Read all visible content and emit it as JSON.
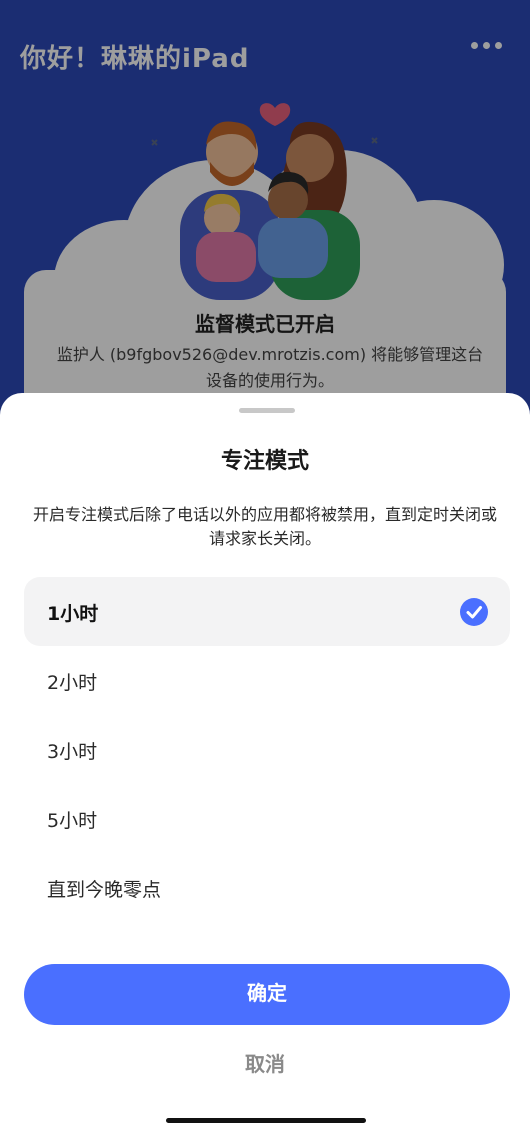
{
  "background": {
    "title": "你好！琳琳的iPad",
    "card_title": "监督模式已开启",
    "card_text": "监护人 (b9fgbov526@dev.mrotzis.com) 将能够管理这台设备的使用行为。",
    "more_icon": "more-horizontal-icon"
  },
  "sheet": {
    "title": "专注模式",
    "description": "开启专注模式后除了电话以外的应用都将被禁用，直到定时关闭或请求家长关闭。",
    "options": [
      {
        "label": "1小时",
        "selected": true
      },
      {
        "label": "2小时",
        "selected": false
      },
      {
        "label": "3小时",
        "selected": false
      },
      {
        "label": "5小时",
        "selected": false
      },
      {
        "label": "直到今晚零点",
        "selected": false
      }
    ],
    "confirm_label": "确定",
    "cancel_label": "取消"
  },
  "colors": {
    "accent": "#4a6fff",
    "header_bg": "#2c49b8"
  }
}
